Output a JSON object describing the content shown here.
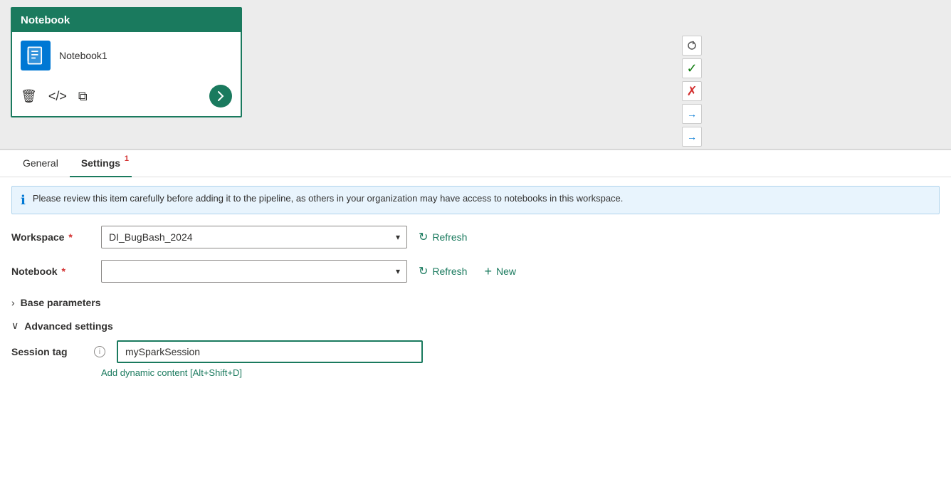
{
  "canvas": {
    "notebook_card": {
      "header": "Notebook",
      "name": "Notebook1"
    },
    "side_buttons": {
      "redo": "↷",
      "check": "✓",
      "x": "✗",
      "arrow_right": "→",
      "arrow_right2": "→"
    }
  },
  "tabs": [
    {
      "id": "general",
      "label": "General",
      "active": false,
      "badge": null
    },
    {
      "id": "settings",
      "label": "Settings",
      "active": true,
      "badge": "1"
    }
  ],
  "info_banner": {
    "text": "Please review this item carefully before adding it to the pipeline, as others in your organization may have access to notebooks in this workspace."
  },
  "form": {
    "workspace_label": "Workspace",
    "workspace_value": "DI_BugBash_2024",
    "workspace_placeholder": "DI_BugBash_2024",
    "notebook_label": "Notebook",
    "notebook_value": "",
    "refresh_label": "Refresh",
    "new_label": "New"
  },
  "sections": {
    "base_parameters_label": "Base parameters",
    "advanced_settings_label": "Advanced settings"
  },
  "session_tag": {
    "label": "Session tag",
    "value": "mySparkSession",
    "dynamic_content_link": "Add dynamic content [Alt+Shift+D]"
  }
}
